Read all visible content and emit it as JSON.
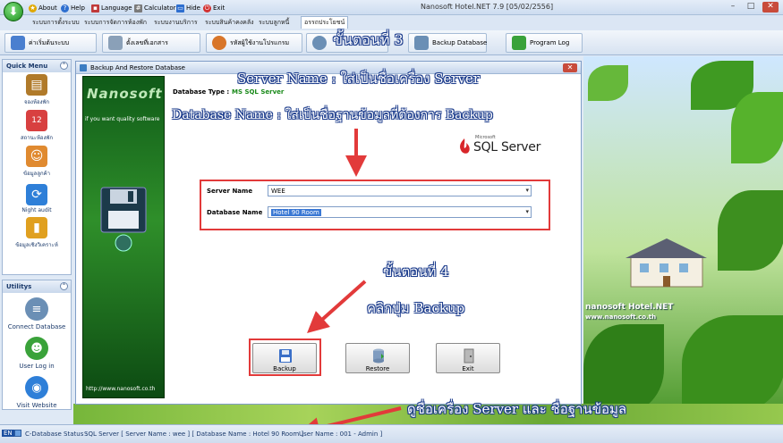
{
  "window": {
    "title": "Nanosoft Hotel.NET 7.9  [05/02/2556]",
    "quick_access": [
      {
        "label": "About",
        "icon": "star-icon",
        "color": "#e0a800"
      },
      {
        "label": "Help",
        "icon": "help-icon",
        "color": "#2e6fd0"
      },
      {
        "label": "Language",
        "icon": "flag-icon",
        "color": "#c03a3a"
      },
      {
        "label": "Calculator",
        "icon": "calculator-icon",
        "color": "#7a7a7a"
      },
      {
        "label": "Hide",
        "icon": "monitor-icon",
        "color": "#2e6fd0"
      },
      {
        "label": "Exit",
        "icon": "power-icon",
        "color": "#d23030"
      }
    ],
    "controls": {
      "minimize": "–",
      "maximize": "□",
      "close": "✕"
    }
  },
  "ribbon": {
    "tabs": [
      "ระบบการตั้งระบบ",
      "ระบบการจัดการห้องพัก",
      "ระบบงานบริการ",
      "ระบบสินค้าคงคลัง",
      "ระบบลูกหนี้",
      "อรรถประโยชน์"
    ],
    "buttons": [
      {
        "label": "ค่าเริ่มต้นระบบ",
        "icon": "settings-icon",
        "color": "#4a7fcf"
      },
      {
        "label": "ตั้งเลขที่เอกสาร",
        "icon": "document-icon",
        "color": "#8aa0b8"
      },
      {
        "label": "รหัสผู้ใช้งานโปรแกรม",
        "icon": "user-icon",
        "color": "#d8762a"
      },
      {
        "label": "",
        "icon": "search-db-icon",
        "color": "#6b8fb5"
      },
      {
        "label": "Backup Database",
        "icon": "database-icon",
        "color": "#6b8fb5"
      },
      {
        "label": "Program Log",
        "icon": "log-icon",
        "color": "#3aa23a"
      }
    ]
  },
  "sidebar": {
    "quick_menu": {
      "title": "Quick Menu",
      "items": [
        {
          "label": "จองห้องพัก",
          "icon": "book-icon",
          "color": "#b07a2a",
          "glyph": "▤"
        },
        {
          "label": "สถานะห้องพัก",
          "icon": "calendar-icon",
          "color": "#d84040",
          "glyph": "12"
        },
        {
          "label": "ข้อมูลลูกค้า",
          "icon": "people-icon",
          "color": "#e08a30",
          "glyph": "☺"
        },
        {
          "label": "Night audit",
          "icon": "refresh-icon",
          "color": "#2e7fd8",
          "glyph": "⟳"
        },
        {
          "label": "ข้อมูลเชิงวิเคราะห์",
          "icon": "bar-chart-icon",
          "color": "#e0a020",
          "glyph": "▮"
        }
      ]
    },
    "utilities": {
      "title": "Utilitys",
      "items": [
        {
          "label": "Connect Database",
          "icon": "database-icon",
          "color": "#6b8fb5",
          "glyph": "≡"
        },
        {
          "label": "User Log in",
          "icon": "user-icon",
          "color": "#3aa23a",
          "glyph": "☻"
        },
        {
          "label": "Visit Website",
          "icon": "globe-icon",
          "color": "#2e7fd8",
          "glyph": "◉"
        }
      ]
    }
  },
  "dialog": {
    "title": "Backup And Restore Database",
    "banner": {
      "logo": "Nanosoft",
      "tagline": "if you want quality software",
      "url": "http://www.nanosoft.co.th"
    },
    "db_type_label": "Database Type :",
    "db_type_value": "MS SQL Server",
    "sql_logo": {
      "small": "Microsoft",
      "text": "SQL Server"
    },
    "server_name_label": "Server Name",
    "server_name_value": "WEE",
    "database_name_label": "Database Name",
    "database_name_value": "Hotel 90 Room",
    "buttons": {
      "backup": "Backup",
      "restore": "Restore",
      "exit": "Exit"
    }
  },
  "background": {
    "brand": "nanosoft Hotel.NET",
    "url": "www.nanosoft.co.th"
  },
  "annotations": {
    "step3": "ขั้นตอนที่ 3",
    "server_hint": "Server Name : ใส่เป็นชื่อเครื่อง Server",
    "db_hint": "Database Name : ใส่เป็นชื่อฐานข้อมูลที่ต้องการ Backup",
    "step4": "ขั้นตอนที่ 4",
    "click_backup": "คลิกปุ่ม Backup",
    "status_hint": "ดูชื่อเครื่อง Server และ ชื่อฐานข้อมูล"
  },
  "status_bar": {
    "lang": "EN",
    "db_status_label": "C-Database Status :",
    "db_status_value": "SQL Server [ Server Name : wee ]  [ Database Name : Hotel 90 Room ]",
    "user": "User Name : 001 - Admin ]"
  }
}
